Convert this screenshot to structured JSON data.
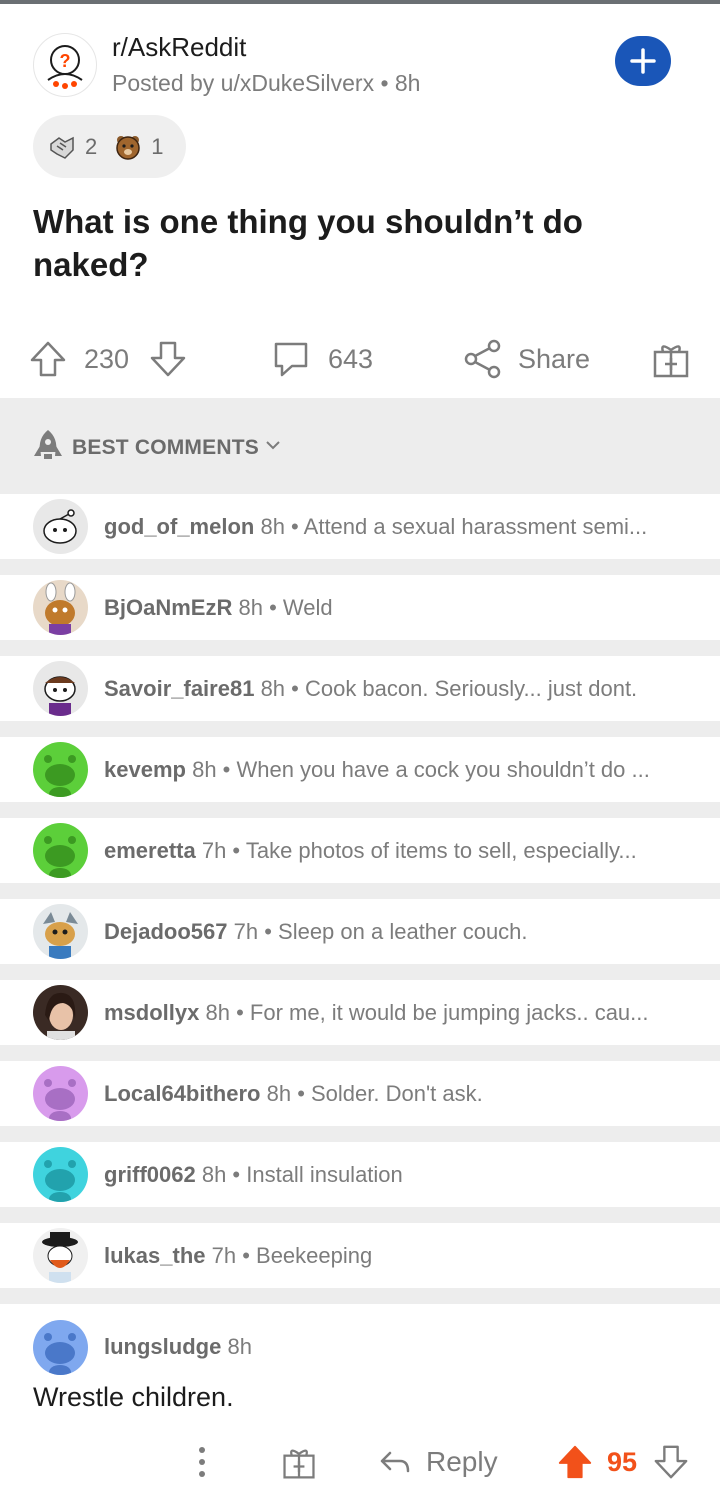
{
  "post": {
    "subreddit": "r/AskReddit",
    "posted_by": "Posted by u/xDukeSilverx • 8h",
    "awards": [
      {
        "icon": "handshake-award-icon",
        "count": "2"
      },
      {
        "icon": "bear-award-icon",
        "count": "1"
      }
    ],
    "title": "What is one thing you shouldn’t do naked?",
    "upvotes": "230",
    "comments": "643",
    "share_label": "Share"
  },
  "section": {
    "label": "BEST COMMENTS"
  },
  "comments": [
    {
      "user": "god_of_melon",
      "meta": "8h • Attend a sexual harassment semi..."
    },
    {
      "user": "BjOaNmEzR",
      "meta": "8h • Weld"
    },
    {
      "user": "Savoir_faire81",
      "meta": "8h • Cook bacon. Seriously... just dont."
    },
    {
      "user": "kevemp",
      "meta": "8h • When you have a cock you shouldn’t do ..."
    },
    {
      "user": "emeretta",
      "meta": "7h • Take photos of items to sell, especially..."
    },
    {
      "user": "Dejadoo567",
      "meta": "7h • Sleep on a leather couch."
    },
    {
      "user": "msdollyx",
      "meta": "8h • For me, it would be jumping jacks.. cau..."
    },
    {
      "user": "Local64bithero",
      "meta": "8h • Solder. Don't ask."
    },
    {
      "user": "griff0062",
      "meta": "8h • Install insulation"
    },
    {
      "user": "lukas_the",
      "meta": "7h • Beekeeping"
    }
  ],
  "expanded_comment": {
    "user": "lungsludge",
    "time": "8h",
    "text": "Wrestle children.",
    "reply_label": "Reply",
    "score": "95"
  },
  "colors": {
    "accent_blue": "#1a56b8",
    "upvote_orange": "#f2511a",
    "muted": "#7c7c7c"
  }
}
